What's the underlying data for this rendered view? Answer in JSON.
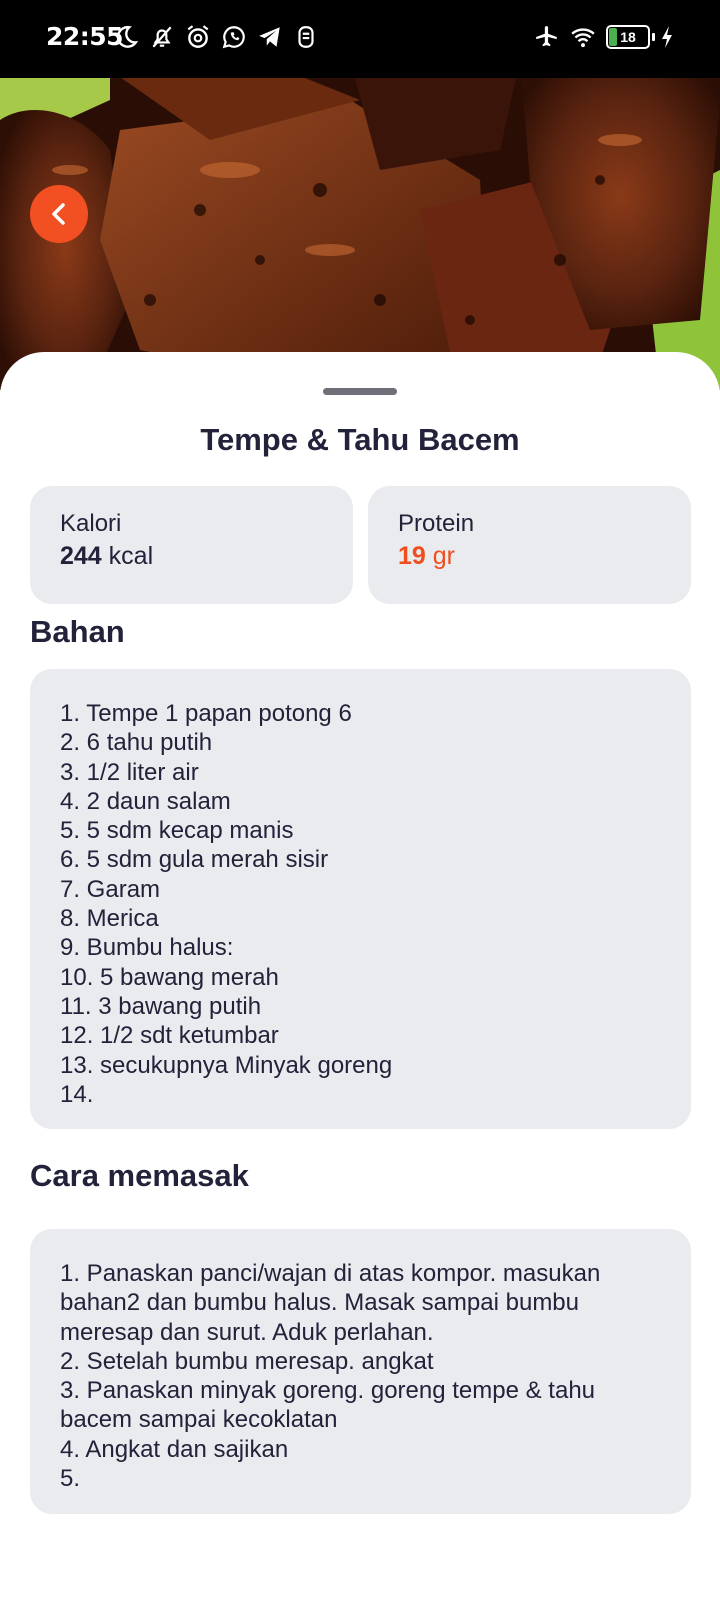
{
  "status_bar": {
    "time": "22:55",
    "battery_level": "18",
    "left_icons": [
      "moon-icon",
      "bell-off-icon",
      "alarm-icon",
      "whatsapp-icon",
      "telegram-icon",
      "app-icon"
    ],
    "right_icons": [
      "airplane-icon",
      "wifi-icon",
      "battery-icon",
      "charging-icon"
    ]
  },
  "hero": {
    "image": "fried tempeh and tofu bacem"
  },
  "back_button": {
    "icon": "chevron-left-icon",
    "color": "#f25022"
  },
  "recipe": {
    "title": "Tempe & Tahu Bacem",
    "kalori": {
      "label": "Kalori",
      "value": "244",
      "unit": "kcal"
    },
    "protein": {
      "label": "Protein",
      "value": "19",
      "unit": "gr",
      "color": "#f04e1d"
    }
  },
  "bahan": {
    "title": "Bahan",
    "items": [
      "1. Tempe 1 papan potong 6",
      "2. 6 tahu putih",
      "3. 1/2 liter air",
      "4. 2 daun salam",
      "5. 5 sdm kecap manis",
      "6. 5 sdm gula merah sisir",
      "7. Garam",
      "8. Merica",
      "9. Bumbu halus:",
      "10. 5 bawang merah",
      "11. 3 bawang putih",
      "12. 1/2 sdt ketumbar",
      "13. secukupnya Minyak goreng",
      "14."
    ]
  },
  "cara_memasak": {
    "title": "Cara memasak",
    "items": [
      "1. Panaskan panci/wajan di atas kompor. masukan bahan2 dan bumbu halus. Masak sampai bumbu meresap dan surut. Aduk perlahan.",
      "2. Setelah bumbu meresap. angkat",
      "3. Panaskan minyak goreng. goreng tempe & tahu bacem sampai kecoklatan",
      "4. Angkat dan sajikan",
      "5."
    ]
  },
  "colors": {
    "accent": "#f04e1d",
    "card": "#e9ebee",
    "text": "#22223a"
  }
}
